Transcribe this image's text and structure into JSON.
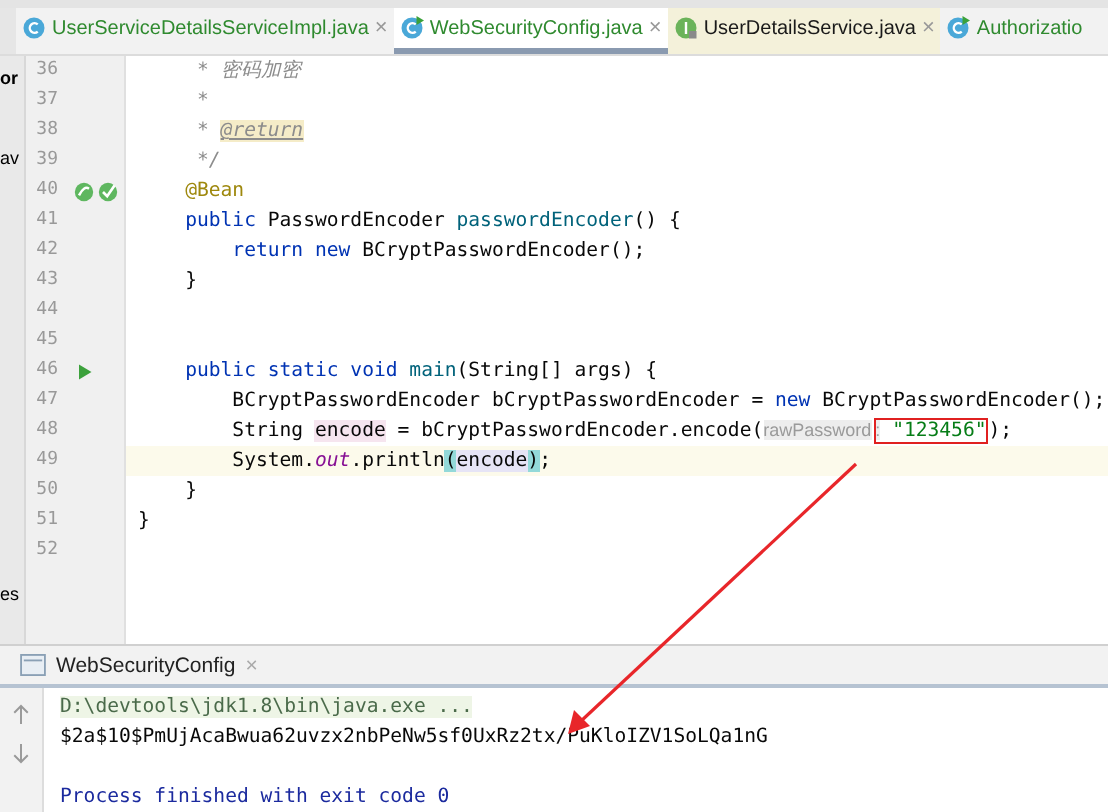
{
  "tabs": [
    {
      "label": "UserServiceDetailsServiceImpl.java",
      "kind": "class",
      "selected": false,
      "highlighted": false,
      "color": "#2f8a2f",
      "close": "×"
    },
    {
      "label": "WebSecurityConfig.java",
      "kind": "runnable-class",
      "selected": true,
      "highlighted": false,
      "color": "#2f8a2f",
      "close": "×"
    },
    {
      "label": "UserDetailsService.java",
      "kind": "interface",
      "selected": false,
      "highlighted": true,
      "color": "#1a1a1a",
      "close": "×"
    },
    {
      "label": "Authorizatio",
      "kind": "runnable-class",
      "selected": false,
      "highlighted": false,
      "color": "#2f8a2f"
    }
  ],
  "sidebar": [
    {
      "text": "or",
      "kind": "top"
    },
    {
      "text": "av",
      "kind": "middle"
    },
    {
      "text": "es",
      "kind": "bottom"
    }
  ],
  "editor": {
    "lines": [
      {
        "number": "36",
        "current": false,
        "segments": [
          {
            "kind": "comment",
            "text": "     * 密码加密"
          }
        ]
      },
      {
        "number": "37",
        "current": false,
        "segments": [
          {
            "kind": "comment",
            "text": "     *"
          }
        ]
      },
      {
        "number": "38",
        "current": false,
        "segments": [
          {
            "kind": "comment",
            "text": "     * "
          },
          {
            "kind": "doctag",
            "text": "@return"
          }
        ]
      },
      {
        "number": "39",
        "current": false,
        "segments": [
          {
            "kind": "comment",
            "text": "     */"
          }
        ]
      },
      {
        "number": "40",
        "current": false,
        "kind": "bean",
        "segments": [
          {
            "kind": "annotation",
            "text": "    @Bean"
          }
        ]
      },
      {
        "number": "41",
        "current": false,
        "segments": [
          {
            "kind": "keyword",
            "text": "    public "
          },
          {
            "kind": "plain",
            "text": "PasswordEncoder "
          },
          {
            "kind": "decl",
            "text": "passwordEncoder"
          },
          {
            "kind": "plain",
            "text": "() {"
          }
        ]
      },
      {
        "number": "42",
        "current": false,
        "segments": [
          {
            "kind": "keyword",
            "text": "        return new "
          },
          {
            "kind": "plain",
            "text": "BCryptPasswordEncoder();"
          }
        ]
      },
      {
        "number": "43",
        "current": false,
        "segments": [
          {
            "kind": "plain",
            "text": "    }"
          }
        ]
      },
      {
        "number": "44",
        "current": false
      },
      {
        "number": "45",
        "current": false
      },
      {
        "number": "46",
        "current": false,
        "kind": "run",
        "segments": [
          {
            "kind": "keyword",
            "text": "    public static void "
          },
          {
            "kind": "decl",
            "text": "main"
          },
          {
            "kind": "plain",
            "text": "(String[] args) {"
          }
        ]
      },
      {
        "number": "47",
        "current": false,
        "segments": [
          {
            "kind": "plain",
            "text": "        BCryptPasswordEncoder bCryptPasswordEncoder = "
          },
          {
            "kind": "keyword",
            "text": "new "
          },
          {
            "kind": "plain",
            "text": "BCryptPasswordEncoder();"
          }
        ]
      },
      {
        "number": "48",
        "current": false,
        "segments": [
          {
            "kind": "plain",
            "text": "        String "
          },
          {
            "kind": "var",
            "text": "encode"
          },
          {
            "kind": "plain",
            "text": " = bCryptPasswordEncoder.encode("
          },
          {
            "kind": "hint",
            "text": "rawPassword"
          },
          {
            "kind": "box",
            "parts": [
              {
                "kind": "hint",
                "text": ":"
              },
              {
                "kind": "string",
                "text": " \"123456\""
              }
            ]
          },
          {
            "kind": "plain",
            "text": ");"
          }
        ]
      },
      {
        "number": "49",
        "current": true,
        "segments": [
          {
            "kind": "plain",
            "text": "        System."
          },
          {
            "kind": "field",
            "text": "out"
          },
          {
            "kind": "plain",
            "text": ".println"
          },
          {
            "kind": "brace",
            "text": "("
          },
          {
            "kind": "usage",
            "text": "encode"
          },
          {
            "kind": "brace",
            "text": ")"
          },
          {
            "kind": "plain",
            "text": ";"
          }
        ]
      },
      {
        "number": "50",
        "current": false,
        "segments": [
          {
            "kind": "plain",
            "text": "    }"
          }
        ]
      },
      {
        "number": "51",
        "current": false,
        "segments": [
          {
            "kind": "plain",
            "text": "}"
          }
        ]
      },
      {
        "number": "52",
        "current": false
      }
    ]
  },
  "console": {
    "tab": {
      "label": "WebSecurityConfig",
      "close": "×"
    },
    "lines": [
      {
        "kind": "command",
        "text": "D:\\devtools\\jdk1.8\\bin\\java.exe ..."
      },
      {
        "kind": "output",
        "text": "$2a$10$PmUjAcaBwua62uvzx2nbPeNw5sf0UxRz2tx/PuKloIZV1SoLQa1nG"
      },
      {
        "kind": "blank"
      },
      {
        "kind": "exit",
        "text": "Process finished with exit code 0"
      }
    ]
  }
}
